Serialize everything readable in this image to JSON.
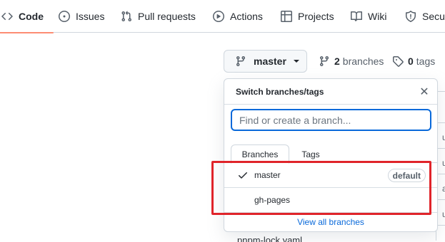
{
  "nav": {
    "items": [
      {
        "label": "Code",
        "icon": "code-icon"
      },
      {
        "label": "Issues",
        "icon": "issue-icon"
      },
      {
        "label": "Pull requests",
        "icon": "pull-request-icon"
      },
      {
        "label": "Actions",
        "icon": "play-icon"
      },
      {
        "label": "Projects",
        "icon": "table-icon"
      },
      {
        "label": "Wiki",
        "icon": "book-icon"
      },
      {
        "label": "Secur",
        "icon": "shield-icon"
      }
    ]
  },
  "branch_button": {
    "label": "master"
  },
  "branches_link": {
    "count": "2",
    "label": "branches"
  },
  "tags_link": {
    "count": "0",
    "label": "tags"
  },
  "dropdown": {
    "title": "Switch branches/tags",
    "close_glyph": "✕",
    "filter_placeholder": "Find or create a branch...",
    "tabs": [
      "Branches",
      "Tags"
    ],
    "items": [
      {
        "label": "master",
        "badge": "default",
        "checked": true
      },
      {
        "label": "gh-pages",
        "checked": false
      }
    ],
    "footer_link": "View all branches"
  },
  "background": {
    "file_name": "pnpm-lock.yaml",
    "row_chars": [
      "u",
      "u",
      "a",
      "u",
      "u",
      "u"
    ]
  },
  "colors": {
    "accent_underline": "#fd8c73",
    "focus_border": "#0969da",
    "link": "#0969da",
    "annotation_box": "#e0242a"
  }
}
